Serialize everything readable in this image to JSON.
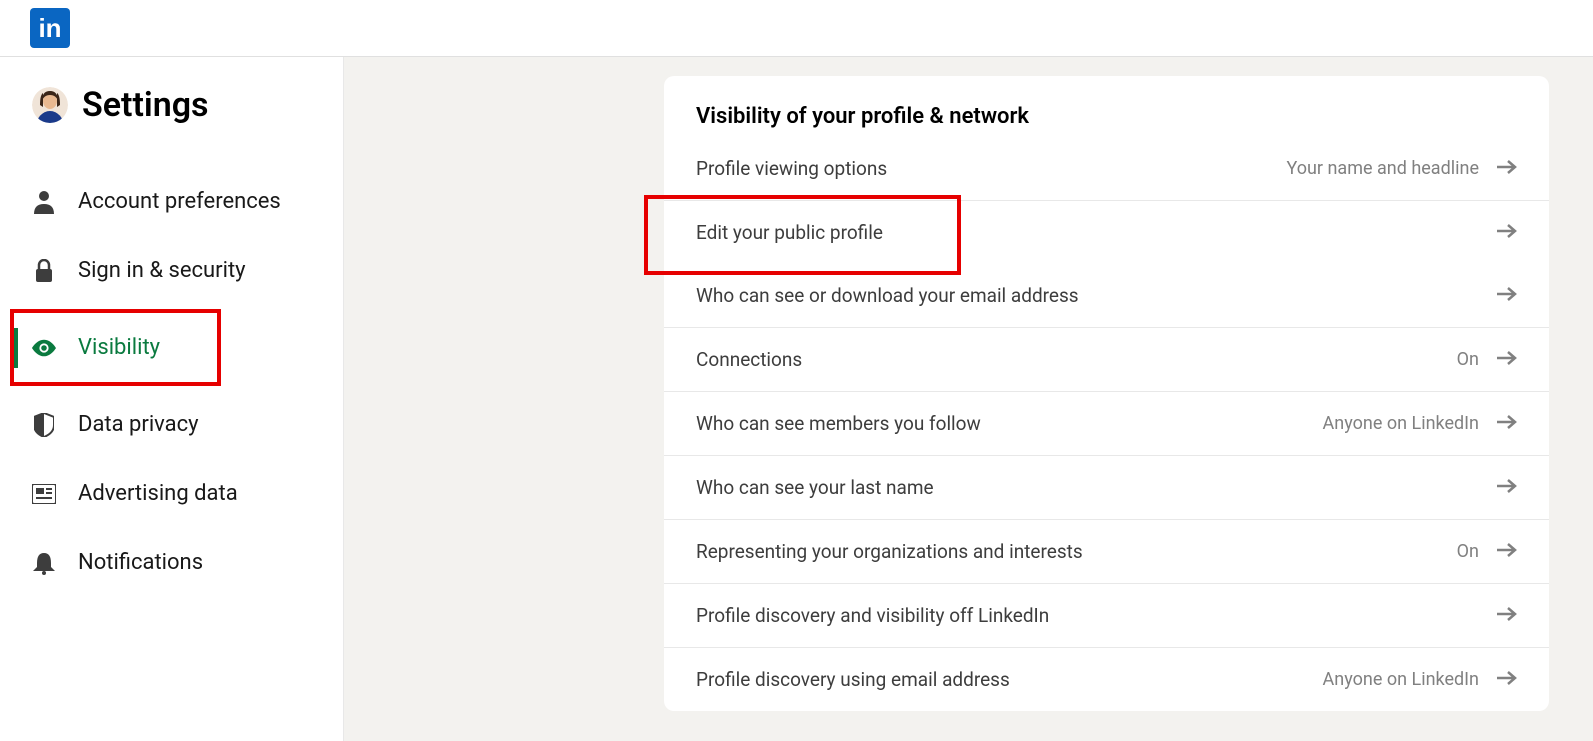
{
  "logo": "in",
  "sidebar": {
    "title": "Settings",
    "items": [
      {
        "label": "Account preferences",
        "icon": "person",
        "active": false
      },
      {
        "label": "Sign in & security",
        "icon": "lock",
        "active": false
      },
      {
        "label": "Visibility",
        "icon": "eye",
        "active": true,
        "highlight": true
      },
      {
        "label": "Data privacy",
        "icon": "shield",
        "active": false
      },
      {
        "label": "Advertising data",
        "icon": "newspaper",
        "active": false
      },
      {
        "label": "Notifications",
        "icon": "bell",
        "active": false
      }
    ]
  },
  "main": {
    "section_title": "Visibility of your profile & network",
    "rows": [
      {
        "label": "Profile viewing options",
        "value": "Your name and headline",
        "highlight": false
      },
      {
        "label": "Edit your public profile",
        "value": "",
        "highlight": true
      },
      {
        "label": "Who can see or download your email address",
        "value": "",
        "highlight": false
      },
      {
        "label": "Connections",
        "value": "On",
        "highlight": false
      },
      {
        "label": "Who can see members you follow",
        "value": "Anyone on LinkedIn",
        "highlight": false
      },
      {
        "label": "Who can see your last name",
        "value": "",
        "highlight": false
      },
      {
        "label": "Representing your organizations and interests",
        "value": "On",
        "highlight": false
      },
      {
        "label": "Profile discovery and visibility off LinkedIn",
        "value": "",
        "highlight": false
      },
      {
        "label": "Profile discovery using email address",
        "value": "Anyone on LinkedIn",
        "highlight": false
      }
    ]
  }
}
